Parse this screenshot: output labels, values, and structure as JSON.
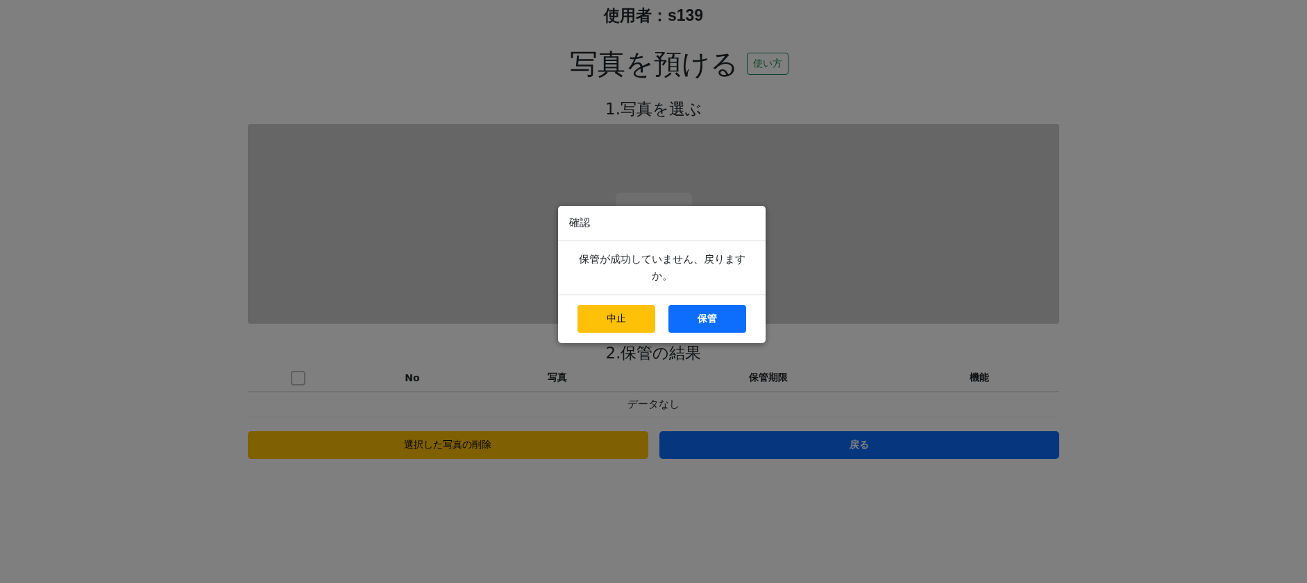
{
  "user": {
    "label": "使用者：",
    "id": "s139"
  },
  "title": "写真を預ける",
  "help_button": "使い方",
  "section_1": {
    "heading": "1.写真を選ぶ"
  },
  "section_2": {
    "heading": "2.保管の結果"
  },
  "table": {
    "select_all": {
      "checked": false
    },
    "columns": [
      "No",
      "写真",
      "保管期限",
      "機能"
    ],
    "empty_text": "データなし"
  },
  "buttons": [
    {
      "kind": "warning",
      "label": "選択した写真の削除"
    },
    {
      "kind": "primary",
      "label": "戻る"
    }
  ],
  "dialog": {
    "title": "確認",
    "message": "保管が成功していません、戻りますか。",
    "buttons": [
      {
        "kind": "warning",
        "label": "中止"
      },
      {
        "kind": "primary",
        "label": "保管"
      }
    ]
  }
}
